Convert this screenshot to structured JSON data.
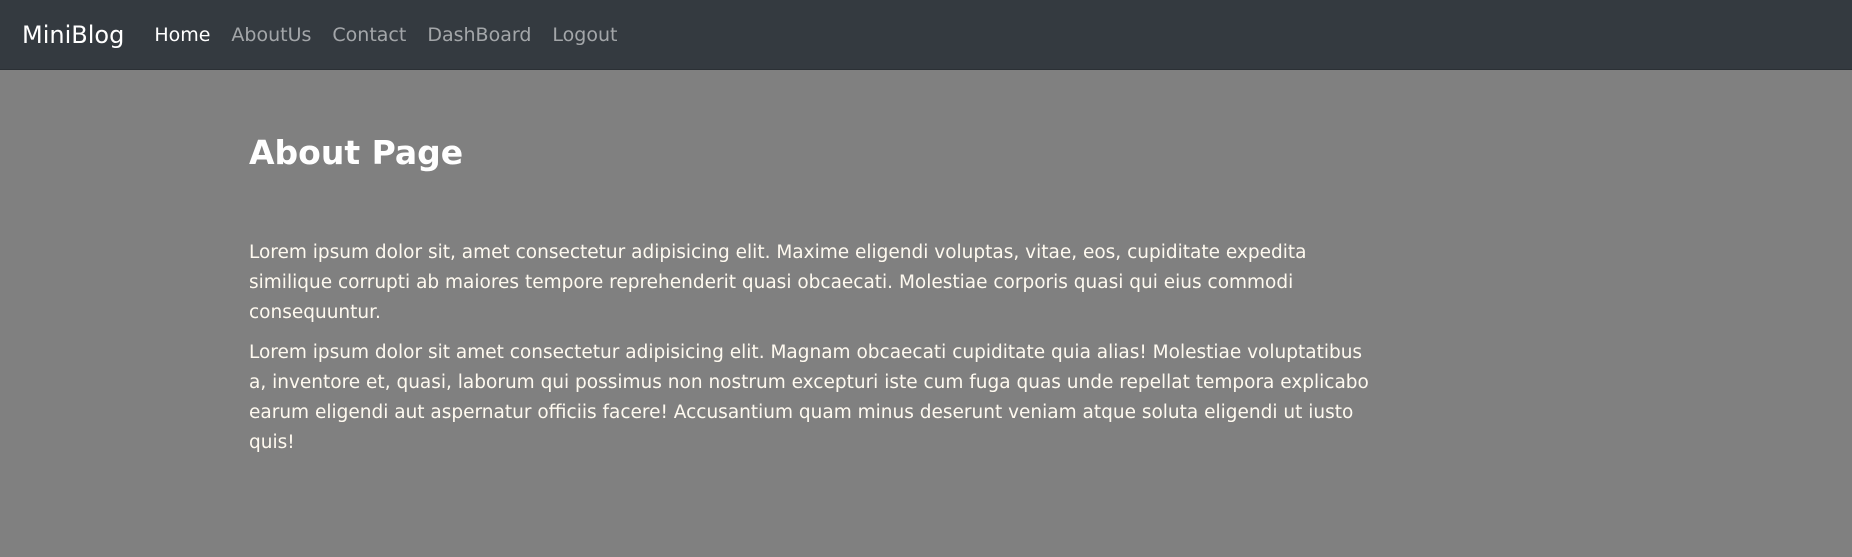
{
  "navbar": {
    "brand": "MiniBlog",
    "links": [
      {
        "label": "Home",
        "active": true
      },
      {
        "label": "AboutUs",
        "active": false
      },
      {
        "label": "Contact",
        "active": false
      },
      {
        "label": "DashBoard",
        "active": false
      },
      {
        "label": "Logout",
        "active": false
      }
    ]
  },
  "main": {
    "title": "About Page",
    "paragraphs": [
      "Lorem ipsum dolor sit, amet consectetur adipisicing elit. Maxime eligendi voluptas, vitae, eos, cupiditate expedita similique corrupti ab maiores tempore reprehenderit quasi obcaecati. Molestiae corporis quasi qui eius commodi consequuntur.",
      "Lorem ipsum dolor sit amet consectetur adipisicing elit. Magnam obcaecati cupiditate quia alias! Molestiae voluptatibus a, inventore et, quasi, laborum qui possimus non nostrum excepturi iste cum fuga quas unde repellat tempora explicabo earum eligendi aut aspernatur officiis facere! Accusantium quam minus deserunt veniam atque soluta eligendi ut iusto quis!"
    ]
  },
  "colors": {
    "navbar_bg": "#343a40",
    "page_bg": "#808080",
    "text": "#fffaf0"
  }
}
